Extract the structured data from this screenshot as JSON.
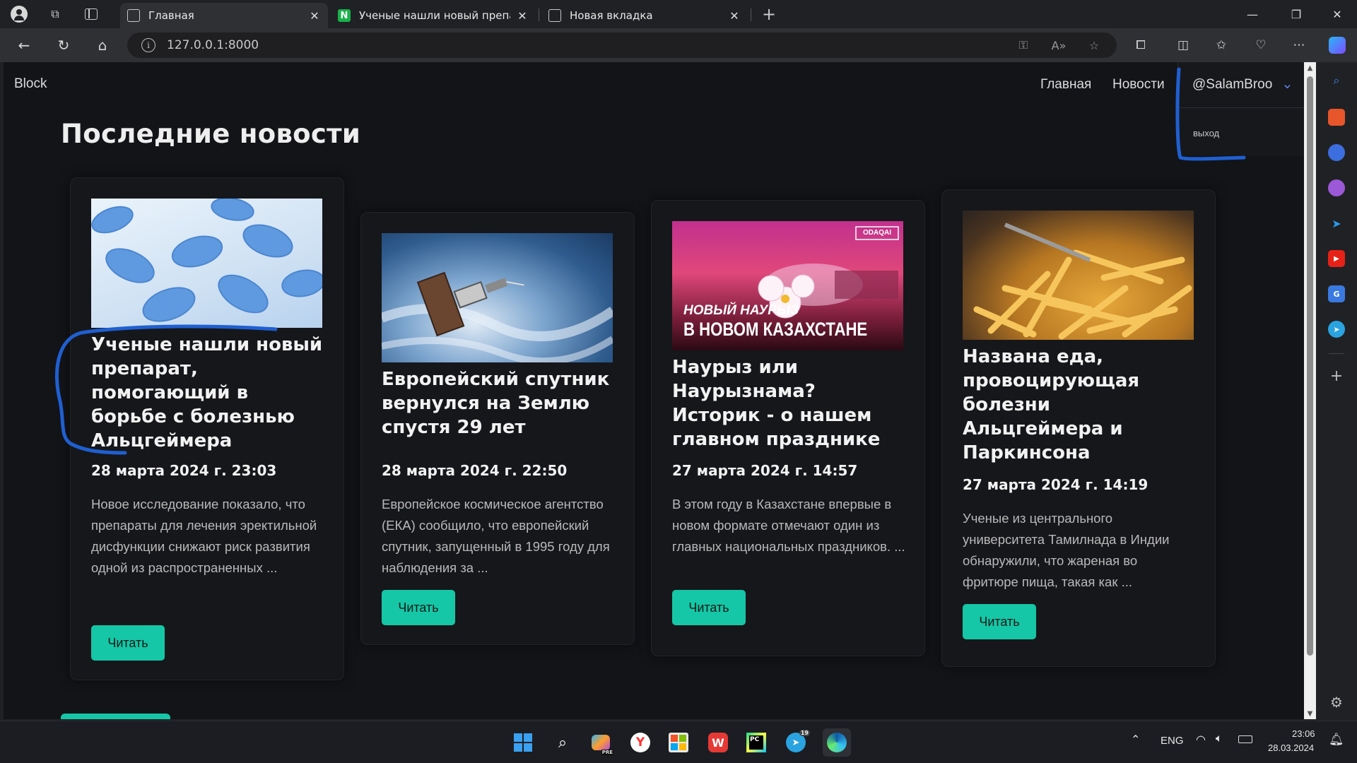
{
  "browser": {
    "tabs": [
      {
        "title": "Главная",
        "active": true
      },
      {
        "title": "Ученые нашли новый препарат",
        "active": false
      },
      {
        "title": "Новая вкладка",
        "active": false
      }
    ],
    "url": "127.0.0.1:8000"
  },
  "site": {
    "brand": "Block",
    "nav": {
      "home": "Главная",
      "news": "Новости"
    },
    "user": {
      "name": "@SalamBroo",
      "logout": "выход"
    },
    "page_title": "Последние новости",
    "read_label": "Читать",
    "cards": [
      {
        "title": "Ученые нашли новый препарат, помогающий в борьбе с болезнью Альцгеймера",
        "date": "28 марта 2024 г. 23:03",
        "excerpt": "Новое исследование показало, что препараты для лечения эректильной дисфункции снижают риск развития одной из распространенных ...",
        "image": "blue-pills"
      },
      {
        "title": "Европейский спутник вернулся на Землю спустя 29 лет",
        "date": "28 марта 2024 г. 22:50",
        "excerpt": "Европейское космическое агентство (ЕКА) сообщило, что европейский спутник, запущенный в 1995 году для наблюдения за ...",
        "image": "satellite-over-earth"
      },
      {
        "title": "Наурыз или Наурызнама? Историк - о нашем главном празднике",
        "date": "27 марта 2024 г. 14:57",
        "excerpt": "В этом году в Казахстане впервые в новом формате отмечают один из главных национальных праздников. ...",
        "image": "nauryz-poster",
        "image_text": {
          "badge": "ODAQAI",
          "line1": "НОВЫЙ НАУРЫЗ",
          "line2": "В НОВОМ КАЗАХСТАНЕ"
        }
      },
      {
        "title": "Названа еда, провоцирующая болезни Альцгеймера и Паркинсона",
        "date": "27 марта 2024 г. 14:19",
        "excerpt": "Ученые из центрального университета Тамилнада в Индии обнаружили, что жареная во фритюре пища, такая как ...",
        "image": "french-fries"
      }
    ]
  },
  "taskbar": {
    "lang": "ENG",
    "time": "23:06",
    "date": "28.03.2024",
    "telegram_badge": "19",
    "copilot_badge": "PRE"
  },
  "colors": {
    "accent": "#15c7a6",
    "page_bg": "#131418",
    "card_bg": "#16171b",
    "annotation": "#1f5fd1"
  }
}
